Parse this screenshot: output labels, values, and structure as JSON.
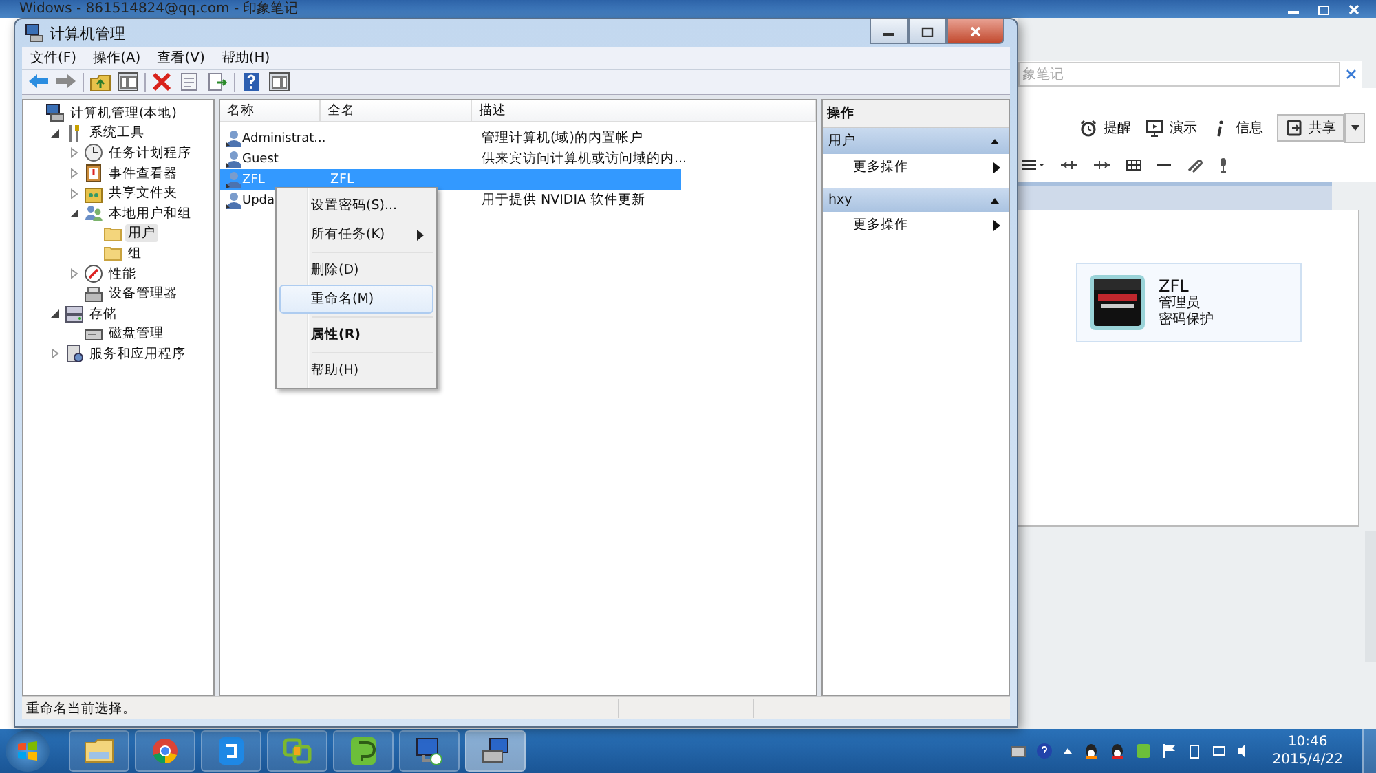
{
  "background_window": {
    "title": "Widows - 861514824@qq.com - 印象笔记",
    "search": {
      "placeholder": "象笔记"
    },
    "toolbar": [
      {
        "kind": "reminder",
        "label": "提醒"
      },
      {
        "kind": "present",
        "label": "演示"
      },
      {
        "kind": "info",
        "label": "信息"
      },
      {
        "kind": "share",
        "label": "共享"
      }
    ],
    "card": {
      "title": "ZFL",
      "lines": [
        "管理员",
        "密码保护"
      ]
    }
  },
  "window": {
    "title": "计算机管理"
  },
  "menu_bar": [
    "文件(F)",
    "操作(A)",
    "查看(V)",
    "帮助(H)"
  ],
  "tree": [
    {
      "label": "计算机管理(本地)",
      "kind": "computer",
      "selected": false,
      "children": [
        {
          "label": "系统工具",
          "kind": "tools",
          "expanded": true,
          "selected": false,
          "children": [
            {
              "label": "任务计划程序",
              "kind": "clock",
              "expanded": false,
              "selected": false
            },
            {
              "label": "事件查看器",
              "kind": "event",
              "expanded": false,
              "selected": false
            },
            {
              "label": "共享文件夹",
              "kind": "share",
              "expanded": false,
              "selected": false
            },
            {
              "label": "本地用户和组",
              "kind": "users",
              "expanded": true,
              "selected": false,
              "children": [
                {
                  "label": "用户",
                  "kind": "folder",
                  "selected": true
                },
                {
                  "label": "组",
                  "kind": "folder",
                  "selected": false
                }
              ]
            },
            {
              "label": "性能",
              "kind": "perf",
              "expanded": false,
              "selected": false
            },
            {
              "label": "设备管理器",
              "kind": "device",
              "selected": false
            }
          ]
        },
        {
          "label": "存储",
          "kind": "storage",
          "expanded": true,
          "selected": false,
          "children": [
            {
              "label": "磁盘管理",
              "kind": "disk",
              "selected": false
            }
          ]
        },
        {
          "label": "服务和应用程序",
          "kind": "services",
          "expanded": false,
          "selected": false
        }
      ]
    }
  ],
  "list": {
    "columns": [
      "名称",
      "全名",
      "描述"
    ],
    "rows": [
      {
        "name": "Administrat...",
        "description": "管理计算机(域)的内置帐户",
        "selected": false
      },
      {
        "name": "Guest",
        "description": "供来宾访问计算机或访问域的内...",
        "selected": false
      },
      {
        "name": "ZFL",
        "full_name": "ZFL",
        "selected": true
      },
      {
        "name": "Upda",
        "description": "用于提供 NVIDIA 软件更新",
        "selected": false
      }
    ]
  },
  "context_menu": [
    {
      "kind": "item",
      "label": "设置密码(S)...",
      "highlighted": false,
      "default": false,
      "submenu": false
    },
    {
      "kind": "item",
      "label": "所有任务(K)",
      "highlighted": false,
      "default": false,
      "submenu": true
    },
    {
      "kind": "separator"
    },
    {
      "kind": "item",
      "label": "删除(D)",
      "highlighted": false,
      "default": false,
      "submenu": false
    },
    {
      "kind": "item",
      "label": "重命名(M)",
      "highlighted": true,
      "default": false,
      "submenu": false
    },
    {
      "kind": "separator"
    },
    {
      "kind": "item",
      "label": "属性(R)",
      "highlighted": false,
      "default": true,
      "submenu": false
    },
    {
      "kind": "separator"
    },
    {
      "kind": "item",
      "label": "帮助(H)",
      "highlighted": false,
      "default": false,
      "submenu": false
    }
  ],
  "actions": {
    "title": "操作",
    "sections": [
      {
        "title": "用户",
        "expanded": true,
        "items": [
          {
            "label": "更多操作",
            "submenu": true
          }
        ]
      },
      {
        "title": "hxy",
        "expanded": true,
        "items": [
          {
            "label": "更多操作",
            "submenu": true
          }
        ]
      }
    ]
  },
  "status_bar": "重命名当前选择。",
  "taskbar": {
    "apps": [
      {
        "kind": "explorer",
        "selected": false
      },
      {
        "kind": "chrome",
        "selected": false
      },
      {
        "kind": "blue",
        "selected": false
      },
      {
        "kind": "vm",
        "selected": false
      },
      {
        "kind": "note",
        "selected": false
      },
      {
        "kind": "remote",
        "selected": false
      },
      {
        "kind": "manage",
        "selected": true
      }
    ],
    "time": "10:46",
    "date": "2015/4/22"
  }
}
